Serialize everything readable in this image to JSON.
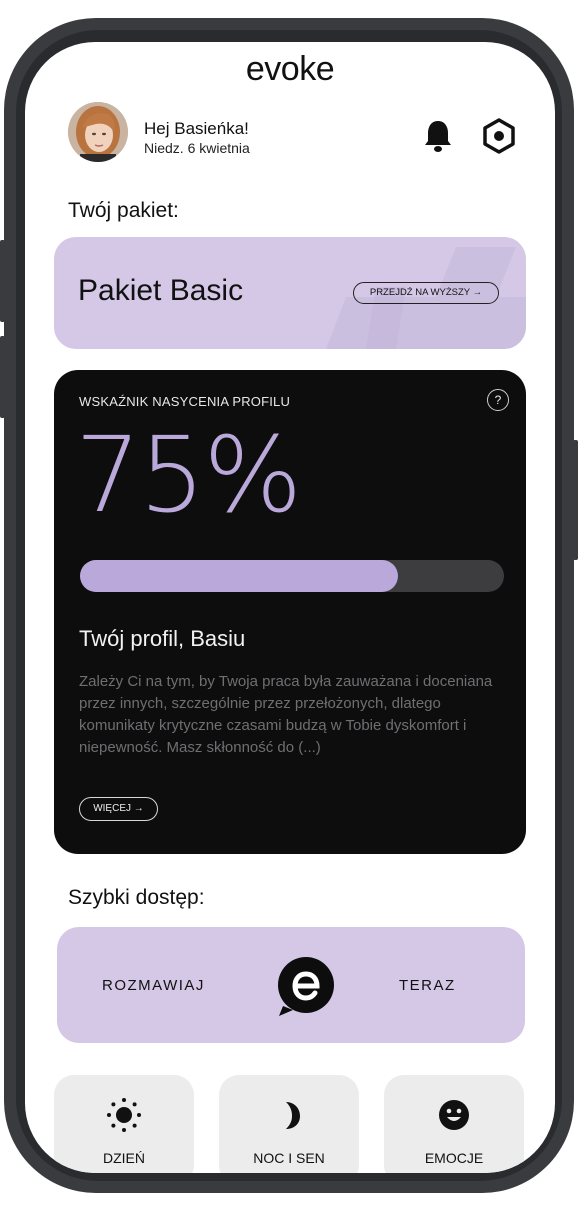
{
  "app": {
    "logo": "evoke"
  },
  "header": {
    "greeting": "Hej Basieńka!",
    "date": "Niedz. 6 kwietnia"
  },
  "package": {
    "section_title": "Twój pakiet:",
    "name": "Pakiet Basic",
    "upgrade_label": "PRZEJDŹ NA WYŻSZY →"
  },
  "profile": {
    "label": "WSKAŹNIK NASYCENIA PROFILU",
    "help": "?",
    "percent_text": "75%",
    "progress": 0.75,
    "title": "Twój profil, Basiu",
    "description": "Zależy Ci na tym, by Twoja praca była zauważana i doceniana przez innych, szczególnie przez przełożonych, dlatego komunikaty krytyczne czasami budzą w Tobie dyskomfort i niepewność. Masz skłonność do (...)",
    "more_label": "WIĘCEJ →"
  },
  "quick_access": {
    "section_title": "Szybki dostęp:",
    "talk_left": "ROZMAWIAJ",
    "talk_right": "TERAZ",
    "tiles": [
      {
        "label": "DZIEŃ",
        "icon": "sun-icon"
      },
      {
        "label": "NOC I SEN",
        "icon": "moon-icon"
      },
      {
        "label": "EMOCJE",
        "icon": "smiley-icon"
      }
    ]
  },
  "colors": {
    "accent": "#b9a8d9",
    "card_lavender": "#d4c8e6",
    "dark_card": "#0d0d0e"
  }
}
